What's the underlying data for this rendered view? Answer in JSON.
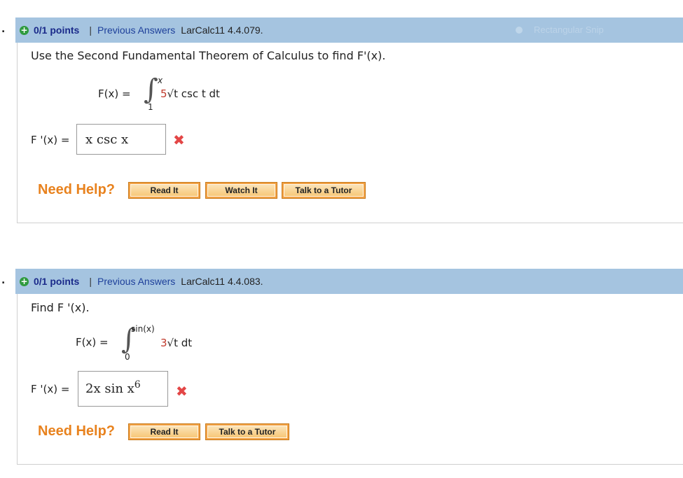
{
  "snip_overlay": "Rectangular Snip",
  "questions": [
    {
      "number": ".",
      "points": "0/1 points",
      "separator": "|",
      "previous_answers": "Previous Answers",
      "code": "LarCalc11 4.4.079.",
      "prompt": "Use the Second Fundamental Theorem of Calculus to find F'(x).",
      "function_label": "F(x) =",
      "upper_limit": "x",
      "lower_limit": "1",
      "coefficient": "5",
      "integrand": "√t csc t dt",
      "answer_label": "F '(x) =",
      "answer_value": "x csc x",
      "need_help": "Need Help?",
      "buttons": [
        "Read It",
        "Watch It",
        "Talk to a Tutor"
      ]
    },
    {
      "number": ".",
      "points": "0/1 points",
      "separator": "|",
      "previous_answers": "Previous Answers",
      "code": "LarCalc11 4.4.083.",
      "prompt": "Find F '(x).",
      "function_label": "F(x) =",
      "upper_limit": "sin(x)",
      "lower_limit": "0",
      "coefficient": "3",
      "integrand": "√t dt",
      "answer_label": "F '(x) =",
      "answer_value": "2x sin x",
      "answer_exponent": "6",
      "need_help": "Need Help?",
      "buttons": [
        "Read It",
        "Talk to a Tutor"
      ]
    }
  ]
}
